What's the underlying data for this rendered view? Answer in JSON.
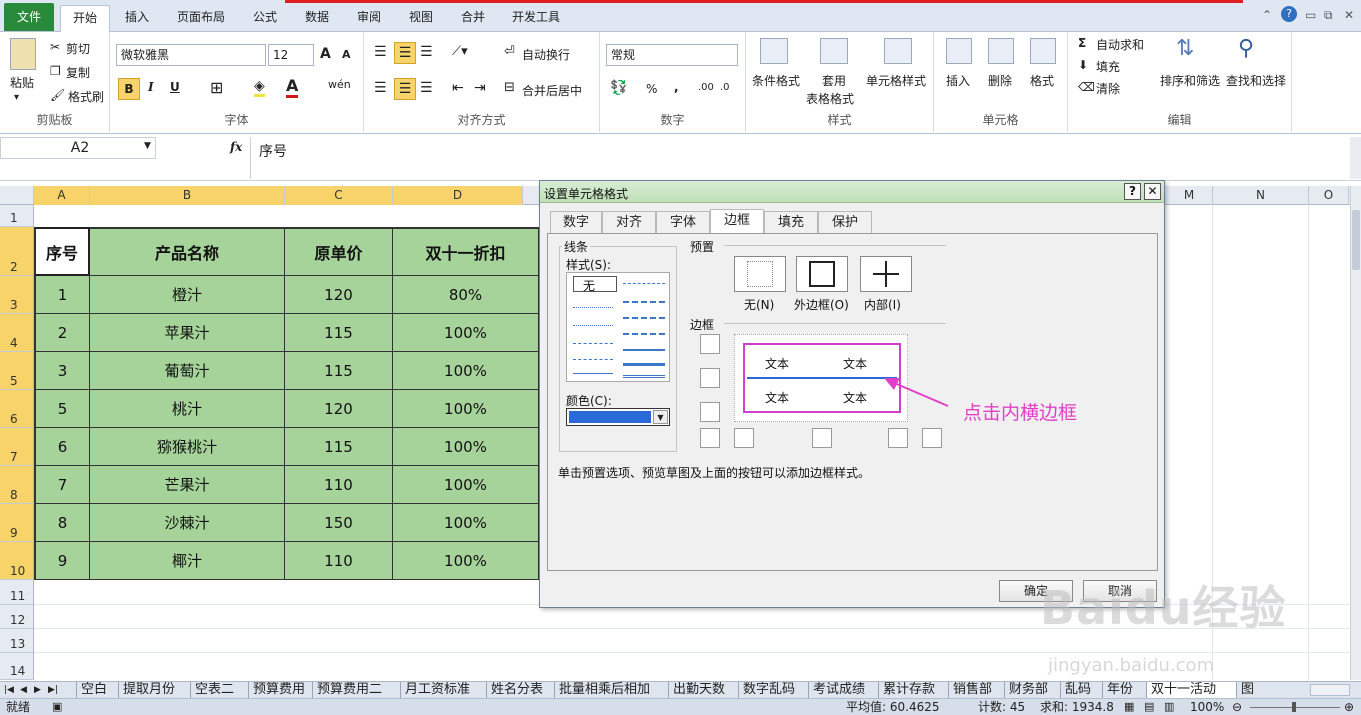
{
  "ribbon_tabs": [
    "文件",
    "开始",
    "插入",
    "页面布局",
    "公式",
    "数据",
    "审阅",
    "视图",
    "合并",
    "开发工具"
  ],
  "clipboard": {
    "paste": "粘贴",
    "cut": "剪切",
    "copy": "复制",
    "painter": "格式刷",
    "label": "剪贴板"
  },
  "font": {
    "name": "微软雅黑",
    "size": "12",
    "bold": "B",
    "italic": "I",
    "underline": "U",
    "label": "字体"
  },
  "align": {
    "wrap": "自动换行",
    "merge": "合并后居中",
    "label": "对齐方式"
  },
  "number": {
    "format": "常规",
    "percent": "%",
    "comma": ",",
    "label": "数字"
  },
  "styles": {
    "cond": "条件格式",
    "table1": "套用",
    "table2": "表格格式",
    "cellstyle": "单元格样式",
    "label": "样式"
  },
  "cells": {
    "insert": "插入",
    "delete": "删除",
    "format": "格式",
    "label": "单元格"
  },
  "editing": {
    "autosum": "自动求和",
    "fill": "填充",
    "clear": "清除",
    "sort": "排序和筛选",
    "find": "查找和选择",
    "label": "编辑"
  },
  "formula": {
    "namebox": "A2",
    "fx": "fx",
    "value": "序号"
  },
  "columns": [
    "A",
    "B",
    "C",
    "D",
    "M",
    "N",
    "O"
  ],
  "rows": [
    "1",
    "2",
    "3",
    "4",
    "5",
    "6",
    "7",
    "8",
    "9",
    "10",
    "11",
    "12",
    "13",
    "14"
  ],
  "table": {
    "headers": [
      "序号",
      "产品名称",
      "原单价",
      "双十一折扣"
    ],
    "rows": [
      [
        "1",
        "橙汁",
        "120",
        "80%"
      ],
      [
        "2",
        "苹果汁",
        "115",
        "100%"
      ],
      [
        "3",
        "葡萄汁",
        "115",
        "100%"
      ],
      [
        "5",
        "桃汁",
        "120",
        "100%"
      ],
      [
        "6",
        "猕猴桃汁",
        "115",
        "100%"
      ],
      [
        "7",
        "芒果汁",
        "110",
        "100%"
      ],
      [
        "8",
        "沙棘汁",
        "150",
        "100%"
      ],
      [
        "9",
        "椰汁",
        "110",
        "100%"
      ]
    ]
  },
  "dialog": {
    "title": "设置单元格格式",
    "help": "?",
    "close": "✕",
    "tabs": [
      "数字",
      "对齐",
      "字体",
      "边框",
      "填充",
      "保护"
    ],
    "line_group": "线条",
    "style_label": "样式(S):",
    "none_style": "无",
    "color_label": "颜色(C):",
    "preset_label": "预置",
    "presets": [
      "无(N)",
      "外边框(O)",
      "内部(I)"
    ],
    "border_label": "边框",
    "preview_text": [
      "文本",
      "文本",
      "文本",
      "文本"
    ],
    "hint": "单击预置选项、预览草图及上面的按钮可以添加边框样式。",
    "ok": "确定",
    "cancel": "取消"
  },
  "callout": "点击内横边框",
  "sheet_tabs": [
    "空白",
    "提取月份",
    "空表二",
    "预算费用",
    "预算费用二",
    "月工资标准",
    "姓名分表",
    "批量相乘后相加",
    "出勤天数",
    "数字乱码",
    "考试成绩",
    "累计存款",
    "销售部",
    "财务部",
    "乱码",
    "年份",
    "双十一活动",
    "图"
  ],
  "status": {
    "ready": "就绪",
    "avg": "平均值: 60.4625",
    "count": "计数: 45",
    "sum": "求和: 1934.8",
    "zoom": "100%"
  },
  "watermark": {
    "main": "Baidu经验",
    "sub": "jingyan.baidu.com"
  },
  "colors": {
    "cell_fill": "#a6d39a",
    "selected_header": "#f7d36a",
    "callout": "#e23fc9",
    "file_tab": "#2a8a3c"
  }
}
